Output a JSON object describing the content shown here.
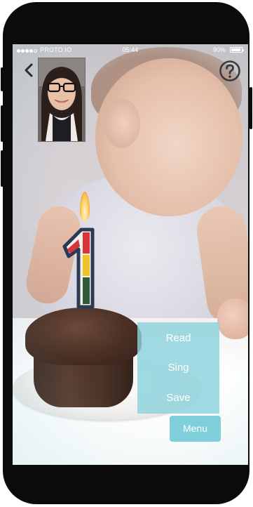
{
  "status_bar": {
    "carrier": "PROTO.IO",
    "time": "05:44",
    "battery_percent": "90%",
    "battery_level": 0.9
  },
  "nav": {
    "back_icon": "chevron-left-icon",
    "help_icon": "question-mark-circle-icon"
  },
  "menu": {
    "items": [
      {
        "label": "Read"
      },
      {
        "label": "Sing"
      },
      {
        "label": "Save"
      }
    ],
    "toggle_label": "Menu"
  },
  "colors": {
    "menu_panel": "#8cd2dc",
    "menu_button": "#7fcfda",
    "text": "#ffffff"
  }
}
